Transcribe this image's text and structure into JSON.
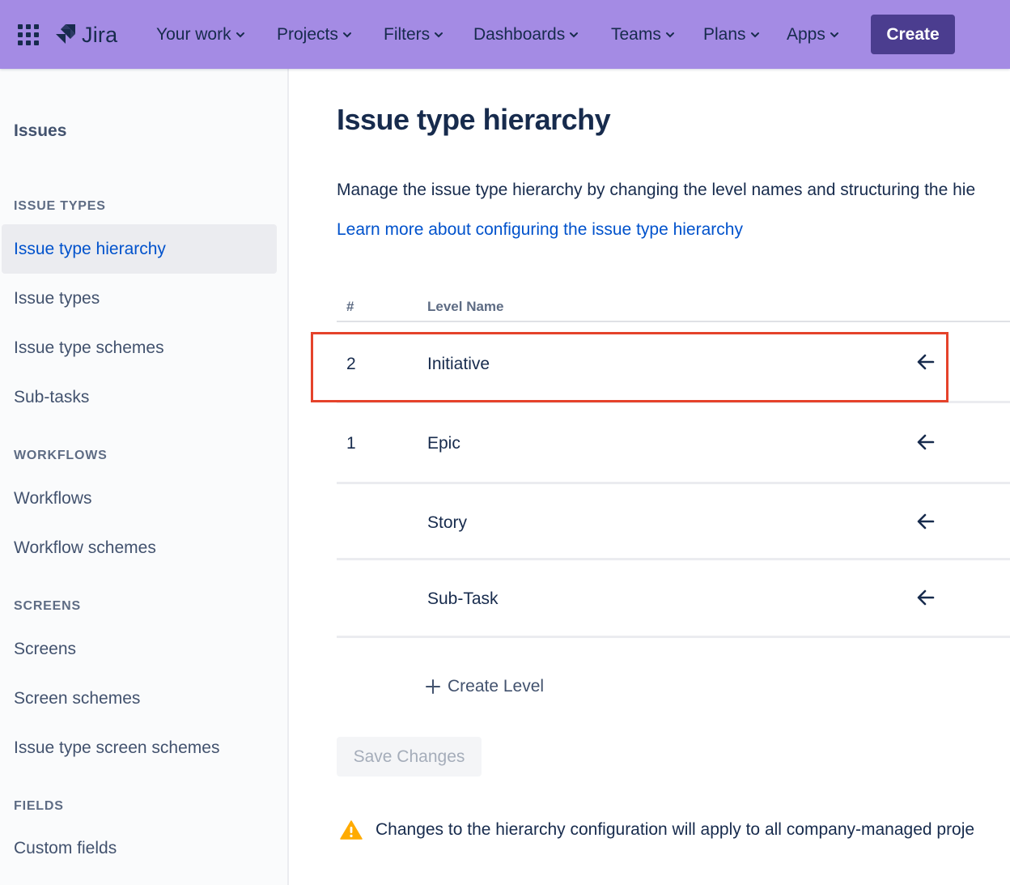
{
  "topnav": {
    "logo_text": "Jira",
    "items": [
      {
        "label": "Your work"
      },
      {
        "label": "Projects"
      },
      {
        "label": "Filters"
      },
      {
        "label": "Dashboards"
      },
      {
        "label": "Teams"
      },
      {
        "label": "Plans"
      },
      {
        "label": "Apps"
      }
    ],
    "create_label": "Create",
    "colors": {
      "bar": "#a48be4",
      "create_button": "#4b3d8f"
    }
  },
  "sidebar": {
    "title": "Issues",
    "sections": [
      {
        "heading": "ISSUE TYPES",
        "items": [
          {
            "label": "Issue type hierarchy",
            "active": true
          },
          {
            "label": "Issue types"
          },
          {
            "label": "Issue type schemes"
          },
          {
            "label": "Sub-tasks"
          }
        ]
      },
      {
        "heading": "WORKFLOWS",
        "items": [
          {
            "label": "Workflows"
          },
          {
            "label": "Workflow schemes"
          }
        ]
      },
      {
        "heading": "SCREENS",
        "items": [
          {
            "label": "Screens"
          },
          {
            "label": "Screen schemes"
          },
          {
            "label": "Issue type screen schemes"
          }
        ]
      },
      {
        "heading": "FIELDS",
        "items": [
          {
            "label": "Custom fields"
          }
        ]
      }
    ]
  },
  "main": {
    "title": "Issue type hierarchy",
    "description": "Manage the issue type hierarchy by changing the level names and structuring the hie",
    "learn_more": "Learn more about configuring the issue type hierarchy",
    "table": {
      "col_number": "#",
      "col_level": "Level Name",
      "rows": [
        {
          "number": "2",
          "level": "Initiative",
          "highlighted": true
        },
        {
          "number": "1",
          "level": "Epic"
        },
        {
          "number": "",
          "level": "Story"
        },
        {
          "number": "",
          "level": "Sub-Task"
        }
      ]
    },
    "create_level": "Create Level",
    "save_changes": "Save Changes",
    "warning": "Changes to the hierarchy configuration will apply to all company-managed proje",
    "colors": {
      "link": "#0052cc",
      "highlight_border": "#e5432b",
      "warning_icon": "#ffab00"
    }
  }
}
